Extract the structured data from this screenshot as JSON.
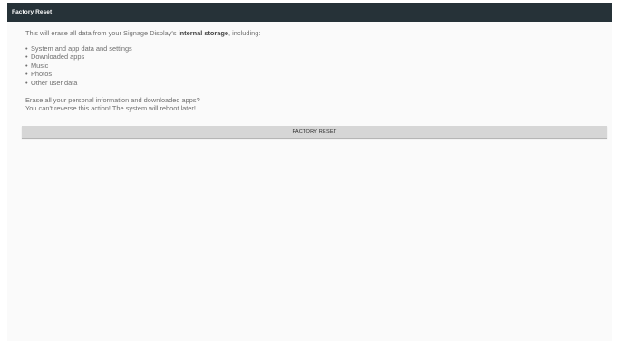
{
  "app_bar": {
    "title": "Factory Reset",
    "background": "#263238"
  },
  "intro": {
    "prefix": "This will erase all data from your Signage Display's ",
    "emphasis": "internal storage",
    "suffix": ", including:"
  },
  "data_items": [
    "System and app data and settings",
    "Downloaded apps",
    "Music",
    "Photos",
    "Other user data"
  ],
  "bullet": "•",
  "warning": {
    "line1": "Erase all your personal information and downloaded apps?",
    "line2": "You can't reverse this action! The system will reboot later!"
  },
  "actions": {
    "factory_reset_label": "FACTORY RESET",
    "button_color": "#d6d6d6"
  }
}
